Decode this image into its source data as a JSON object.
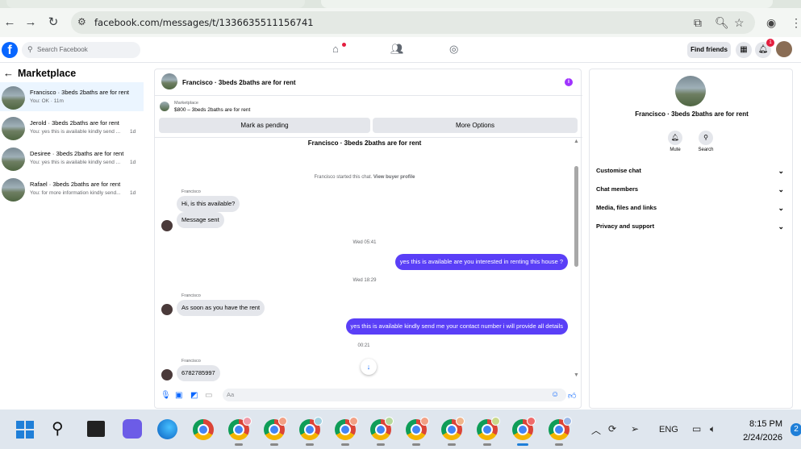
{
  "browser": {
    "url": "facebook.com/messages/t/1336635511156741"
  },
  "fb_header": {
    "search_placeholder": "Search Facebook",
    "find_friends": "Find friends",
    "notifications_count": "1"
  },
  "left_panel": {
    "title": "Marketplace",
    "conversations": [
      {
        "name": "Francisco · 3beds 2baths are for rent",
        "preview": "You: OK · 11m",
        "time": ""
      },
      {
        "name": "Jerold · 3beds 2baths are for rent",
        "preview": "You: yes this is available kindly send ...",
        "time": "1d"
      },
      {
        "name": "Desiree · 3beds 2baths are for rent",
        "preview": "You: yes this is available kindly send ...",
        "time": "1d"
      },
      {
        "name": "Rafael · 3beds 2baths are for rent",
        "preview": "You: for more information kindly send...",
        "time": "1d"
      }
    ]
  },
  "chat": {
    "header_title": "Francisco · 3beds 2baths are for rent",
    "marketplace_label": "Marketplace",
    "listing": "$800 – 3beds 2baths are for rent",
    "mark_pending": "Mark as pending",
    "more_options": "More Options",
    "chat_title": "Francisco · 3beds 2baths are for rent",
    "started_text": "Francisco started this chat.",
    "view_buyer": "View buyer profile",
    "messages": [
      {
        "sender": "Francisco",
        "text": "Hi, is this available?"
      },
      {
        "sender": "",
        "text": "Message sent"
      },
      {
        "time": "Wed 05:41"
      },
      {
        "text": "yes this is available are you interested in renting this house ?"
      },
      {
        "time": "Wed 18:29"
      },
      {
        "sender": "Francisco",
        "text": "As soon as you have the rent"
      },
      {
        "text": "yes this is available kindly send me your contact number i will provide all  details"
      },
      {
        "time": "00:21"
      },
      {
        "sender": "Francisco",
        "text": "6782785997"
      }
    ],
    "composer_placeholder": "Aa"
  },
  "right_panel": {
    "title": "Francisco · 3beds 2baths are for rent",
    "mute": "Mute",
    "search": "Search",
    "rows": [
      "Customise chat",
      "Chat members",
      "Media, files and links",
      "Privacy and support"
    ]
  },
  "taskbar": {
    "lang": "ENG",
    "time": "8:15 PM",
    "date": "2/24/2026",
    "notif": "2"
  }
}
